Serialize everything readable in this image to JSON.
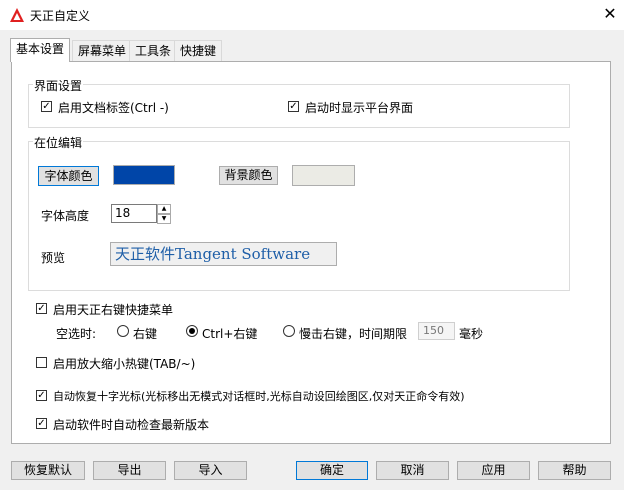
{
  "window": {
    "title": "天正自定义",
    "close_glyph": "✕"
  },
  "tabs": [
    "基本设置",
    "屏幕菜单",
    "工具条",
    "快捷键"
  ],
  "interface": {
    "legend": "界面设置",
    "doc_tabs_label": "启用文档标签(Ctrl -)",
    "platform_label": "启动时显示平台界面"
  },
  "inplace": {
    "legend": "在位编辑",
    "font_color_btn": "字体颜色",
    "font_color": "#0045a8",
    "bg_color_btn": "背景颜色",
    "bg_color": "#ebebe5",
    "font_height_label": "字体高度",
    "font_height_value": "18",
    "preview_label": "预览",
    "preview_text": "天正软件Tangent Software"
  },
  "right_click": {
    "label": "启用天正右键快捷菜单",
    "empty_select_label": "空选时:",
    "opt_right": "右键",
    "opt_ctrl_right": "Ctrl+右键",
    "opt_slow": "慢击右键，时间期限",
    "time_value": "150",
    "time_unit": "毫秒"
  },
  "zoom_hotkey_label": "启用放大缩小热键(TAB/~)",
  "restore_cursor_label": "自动恢复十字光标(光标移出无模式对话框时,光标自动设回绘图区,仅对天正命令有效)",
  "auto_update_label": "启动软件时自动检查最新版本",
  "check_glyph": "✓",
  "footer": {
    "restore_defaults": "恢复默认",
    "export": "导出",
    "import": "导入",
    "ok": "确定",
    "cancel": "取消",
    "apply": "应用",
    "help": "帮助"
  },
  "colors": {
    "focus": "#0078d7",
    "app_icon": "#e02020"
  }
}
